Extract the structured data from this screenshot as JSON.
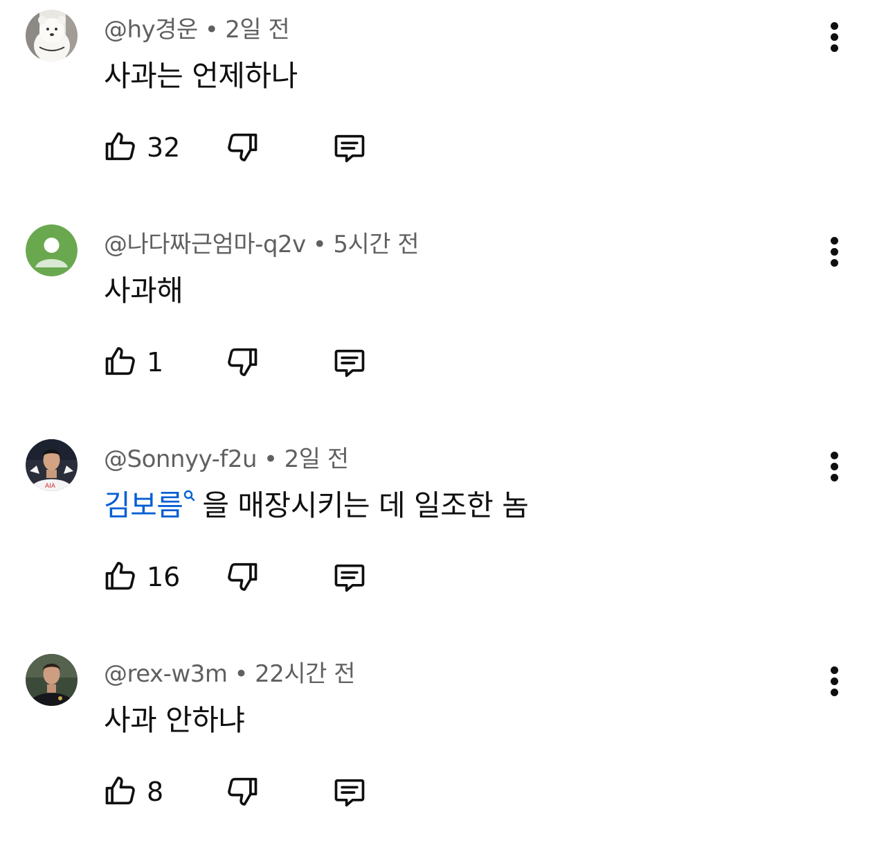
{
  "comments": [
    {
      "author": "@hy경운",
      "age": "2일 전",
      "text": "사과는 언제하나",
      "likes": "32",
      "avatar_icon": "polar-bear-avatar"
    },
    {
      "author": "@나다짜근엄마-q2v",
      "age": "5시간 전",
      "text": "사과해",
      "likes": "1",
      "avatar_icon": "default-user-avatar"
    },
    {
      "author": "@Sonnyy-f2u",
      "age": "2일 전",
      "text_link": "김보름",
      "text": "을 매장시키는 데 일조한 놈",
      "likes": "16",
      "avatar_icon": "footballer-avatar"
    },
    {
      "author": "@rex-w3m",
      "age": "22시간 전",
      "text": "사과 안하냐",
      "likes": "8",
      "avatar_icon": "footballer-dark-avatar"
    }
  ],
  "separator": "•",
  "colors": {
    "meta_text": "#606060",
    "body_text": "#0f0f0f",
    "link": "#065fd4",
    "default_avatar_bg": "#6aa84f"
  }
}
